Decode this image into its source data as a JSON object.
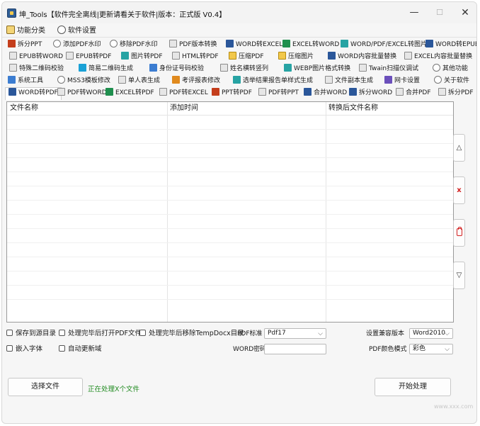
{
  "window": {
    "title": "坤_Tools【软件完全离线|更新请看关于软件|版本：正式版 V0.4】",
    "minimize": "—",
    "maximize": "☐",
    "close": "✕"
  },
  "menu": {
    "items": [
      {
        "label": "功能分类",
        "icon": "box-icon"
      },
      {
        "label": "软件设置",
        "icon": "gear-icon"
      }
    ]
  },
  "tabs": {
    "rows": [
      [
        {
          "label": "拆分PPT",
          "icon": "pdf-icon"
        },
        {
          "label": "添加PDF水印",
          "icon": "watermark-icon"
        },
        {
          "label": "移除PDF水印",
          "icon": "watermark-icon"
        },
        {
          "label": "PDF版本转换",
          "icon": "pdf-icon"
        },
        {
          "label": "WORD转EXCEL",
          "icon": "word-icon"
        },
        {
          "label": "EXCEL转WORD",
          "icon": "excel-icon"
        },
        {
          "label": "WORD/PDF/EXCEL转图片",
          "icon": "image-icon"
        },
        {
          "label": "WORD转EPUB",
          "icon": "word-icon"
        }
      ],
      [
        {
          "label": "EPUB转WORD",
          "icon": "epub-icon"
        },
        {
          "label": "EPUB转PDF",
          "icon": "epub-icon"
        },
        {
          "label": "图片转PDF",
          "icon": "image-icon"
        },
        {
          "label": "HTML转PDF",
          "icon": "html-icon"
        },
        {
          "label": "压缩PDF",
          "icon": "compress-icon"
        },
        {
          "label": "压缩图片",
          "icon": "compress-icon"
        },
        {
          "label": "WORD内容批量替换",
          "icon": "word-icon"
        },
        {
          "label": "EXCEL内容批量替换",
          "icon": "excel-icon"
        }
      ],
      [
        {
          "label": "特殊二维码校验",
          "icon": "qrcode-icon"
        },
        {
          "label": "简易二维码生成",
          "icon": "qrcode-icon"
        },
        {
          "label": "身份证号码校验",
          "icon": "idcard-icon"
        },
        {
          "label": "姓名横转竖列",
          "icon": "list-icon"
        },
        {
          "label": "WEBP图片格式转换",
          "icon": "image-icon"
        },
        {
          "label": "Twain扫描仪调试",
          "icon": "scanner-icon"
        },
        {
          "label": "其他功能",
          "icon": "more-icon"
        }
      ],
      [
        {
          "label": "系统工具",
          "icon": "settings-icon"
        },
        {
          "label": "MSS3模板修改",
          "icon": "gear-icon"
        },
        {
          "label": "单人表生成",
          "icon": "sheet-icon"
        },
        {
          "label": "考评报表修改",
          "icon": "report-icon"
        },
        {
          "label": "选举结果报告单样式生成",
          "icon": "doc-icon"
        },
        {
          "label": "文件副本生成",
          "icon": "copy-icon"
        },
        {
          "label": "网卡设置",
          "icon": "network-icon"
        },
        {
          "label": "关于软件",
          "icon": "info-icon"
        }
      ],
      [
        {
          "label": "WORD转PDF",
          "icon": "word-icon",
          "selected": true
        },
        {
          "label": "PDF转WORD",
          "icon": "pdf-icon"
        },
        {
          "label": "EXCEL转PDF",
          "icon": "excel-icon"
        },
        {
          "label": "PDF转EXCEL",
          "icon": "pdf-icon"
        },
        {
          "label": "PPT转PDF",
          "icon": "ppt-icon"
        },
        {
          "label": "PDF转PPT",
          "icon": "pdf-icon"
        },
        {
          "label": "合并WORD",
          "icon": "word-icon"
        },
        {
          "label": "拆分WORD",
          "icon": "word-icon"
        },
        {
          "label": "合并PDF",
          "icon": "pdf-icon"
        },
        {
          "label": "拆分PDF",
          "icon": "pdf-icon"
        }
      ]
    ]
  },
  "table": {
    "columns": [
      "文件名称",
      "添加时间",
      "转换后文件名称"
    ],
    "rows": []
  },
  "side_buttons": {
    "up": "△",
    "delete": "x",
    "down": "▽"
  },
  "options": {
    "save_to_source": "保存到源目录",
    "open_after": "处理完毕后打开PDF文件",
    "remove_temp": "处理完毕后移除TempDocx目录",
    "embed_fonts": "嵌入字体",
    "auto_update": "自动更新域",
    "pdf_standard_label": "PDF标准",
    "pdf_standard_value": "Pdf17",
    "compat_label": "设置兼容版本",
    "compat_value": "Word2010",
    "word_password_label": "WORD密码",
    "word_password_value": "",
    "pdf_color_label": "PDF颜色模式",
    "pdf_color_value": "彩色"
  },
  "actions": {
    "select_files": "选择文件",
    "status": "正在处理X个文件",
    "start": "开始处理"
  },
  "watermark": "www.xxx.com"
}
